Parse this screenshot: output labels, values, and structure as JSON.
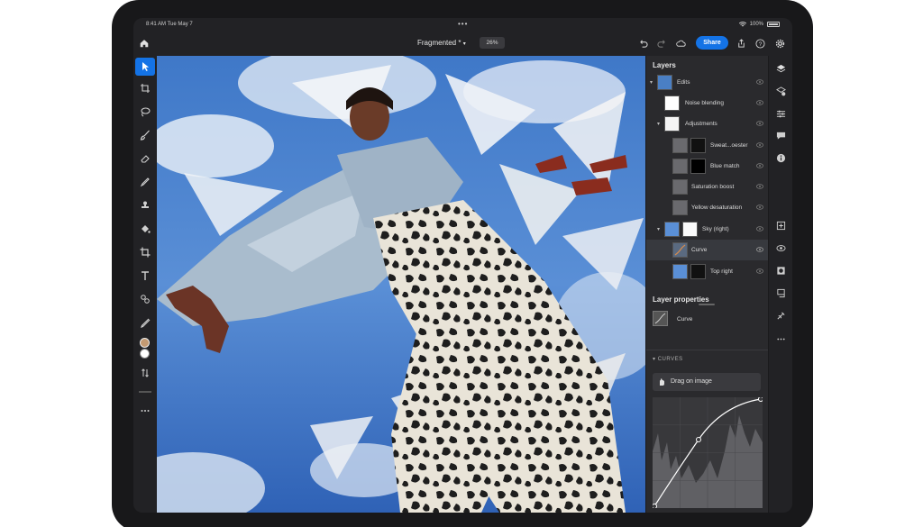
{
  "status_bar": {
    "time": "8:41 AM   Tue May 7",
    "battery": "100%"
  },
  "top_bar": {
    "document_title": "Fragmented *",
    "zoom": "26%",
    "share_label": "Share"
  },
  "left_tools": [
    "move-tool-icon",
    "crop-transform-icon",
    "lasso-icon",
    "brush-icon",
    "eraser-icon",
    "healing-icon",
    "clone-stamp-icon",
    "paint-bucket-icon",
    "crop-icon",
    "type-icon",
    "content-aware-icon",
    "eyedropper-icon"
  ],
  "layers": {
    "title": "Layers",
    "items": [
      {
        "name": "Edits",
        "indent": 0,
        "caret": "▾",
        "thumb": "image"
      },
      {
        "name": "Noise blending",
        "indent": 1,
        "caret": "",
        "thumb": "noise"
      },
      {
        "name": "Adjustments",
        "indent": 1,
        "caret": "▾",
        "thumb": "white"
      },
      {
        "name": "Sweat...oester",
        "indent": 2,
        "caret": "",
        "thumb": "adj-mask"
      },
      {
        "name": "Blue match",
        "indent": 2,
        "caret": "",
        "thumb": "adj-mask-dark"
      },
      {
        "name": "Saturation boost",
        "indent": 2,
        "caret": "",
        "thumb": "adj"
      },
      {
        "name": "Yellow desaturation",
        "indent": 2,
        "caret": "",
        "thumb": "adj"
      },
      {
        "name": "Sky (right)",
        "indent": 1,
        "caret": "▾",
        "thumb": "sky-mask"
      },
      {
        "name": "Curve",
        "indent": 2,
        "caret": "",
        "thumb": "curve",
        "selected": true
      },
      {
        "name": "Top right",
        "indent": 2,
        "caret": "",
        "thumb": "sky-mask2"
      }
    ]
  },
  "layer_properties": {
    "title": "Layer properties",
    "layer_name": "Curve"
  },
  "curves": {
    "section_label": "CURVES",
    "drag_label": "Drag on image",
    "channels": [
      "#9a9a9a",
      "#e03a3a",
      "#3ab04a",
      "#3a7ae0"
    ]
  },
  "colors": {
    "accent": "#1473e6",
    "panel": "#2a2a2d",
    "foreground_swatch": "#c49a72",
    "background_swatch": "#ffffff"
  }
}
